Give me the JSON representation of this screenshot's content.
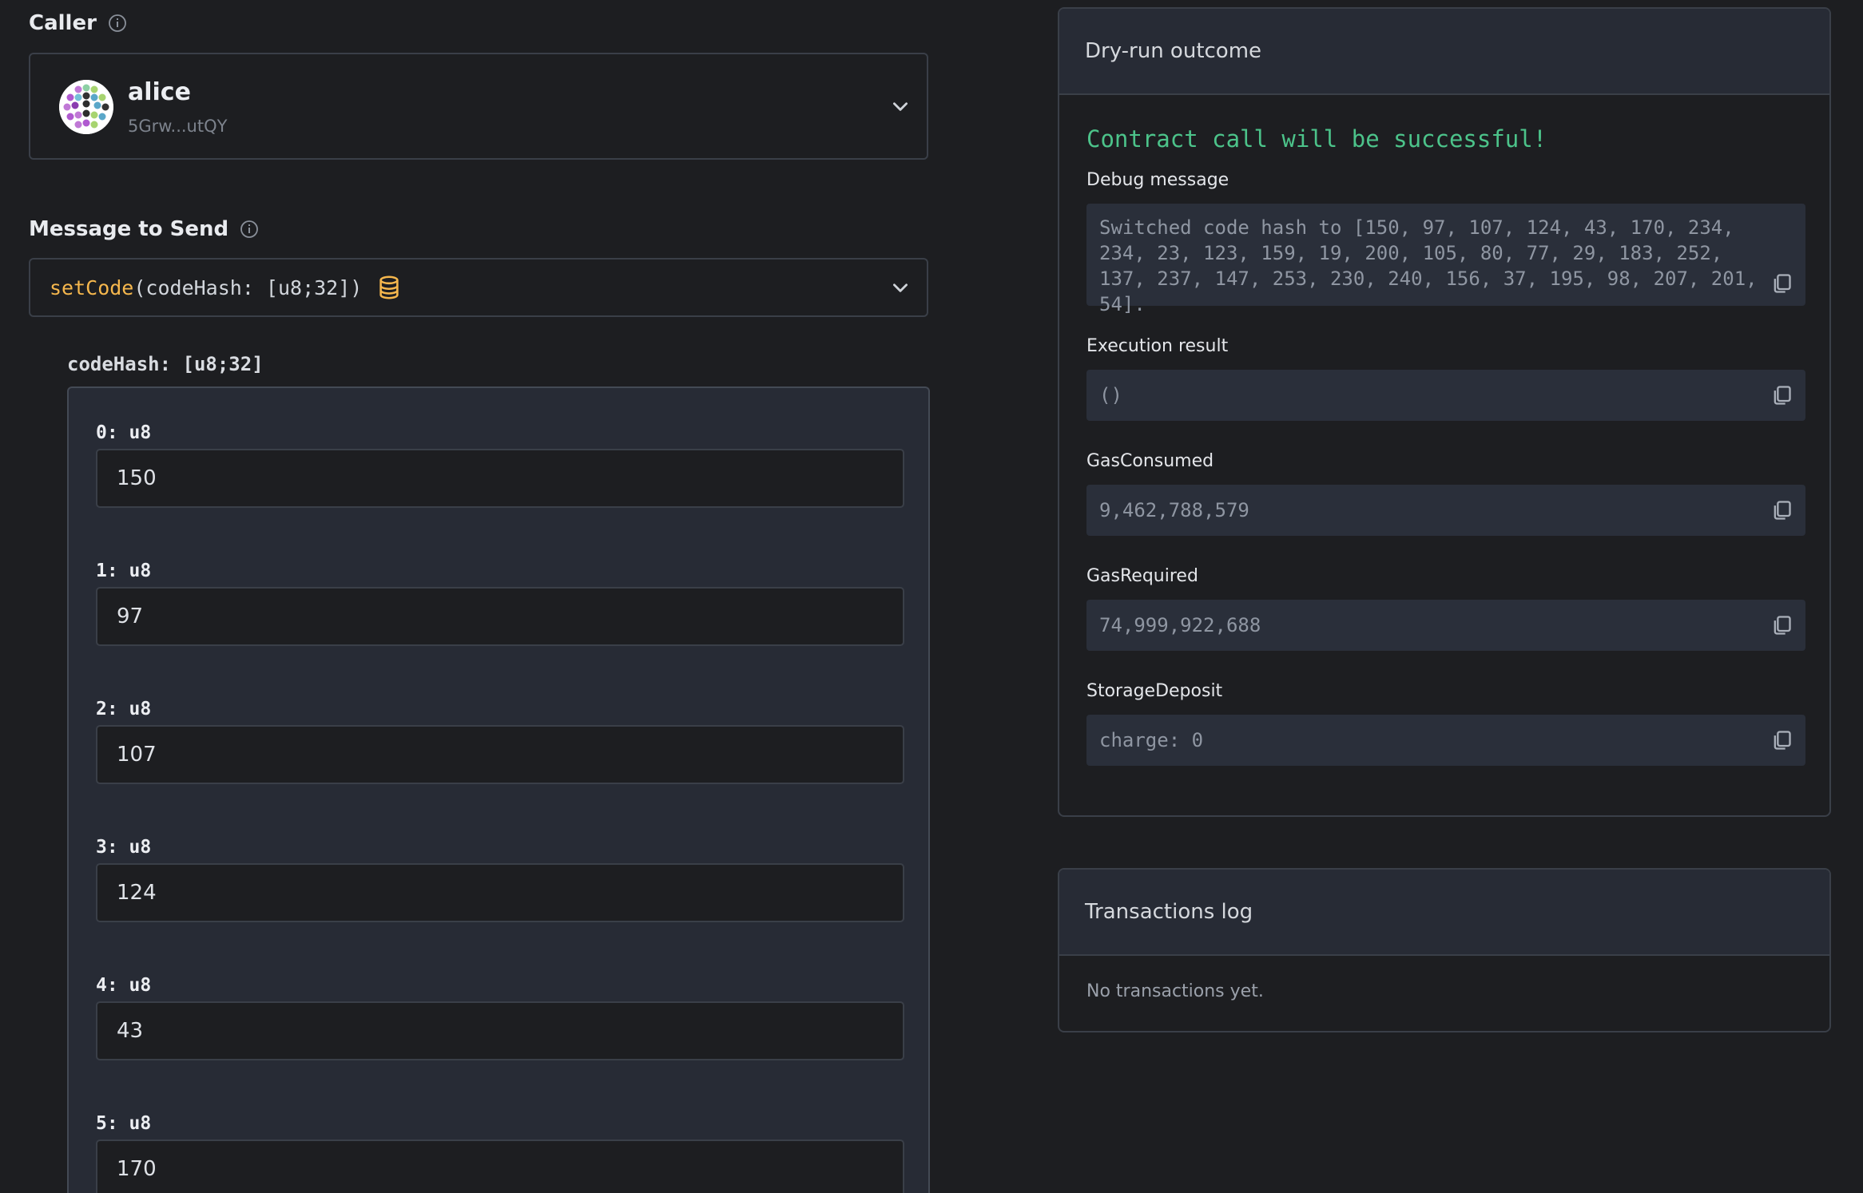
{
  "caller": {
    "label": "Caller",
    "account_name": "alice",
    "account_address": "5Grw...utQY"
  },
  "message": {
    "label": "Message to Send",
    "function_name": "setCode",
    "function_args": "(codeHash: [u8;32])"
  },
  "parameter": {
    "label": "codeHash: [u8;32]",
    "fields": [
      {
        "label": "0: u8",
        "value": "150"
      },
      {
        "label": "1: u8",
        "value": "97"
      },
      {
        "label": "2: u8",
        "value": "107"
      },
      {
        "label": "3: u8",
        "value": "124"
      },
      {
        "label": "4: u8",
        "value": "43"
      },
      {
        "label": "5: u8",
        "value": "170"
      }
    ]
  },
  "dry_run": {
    "title": "Dry-run outcome",
    "status": "Contract call will be successful!",
    "debug_label": "Debug message",
    "debug_value": "Switched code hash to [150, 97, 107, 124, 43, 170, 234, 234, 23, 123, 159, 19, 200, 105, 80, 77, 29, 183, 252, 137, 237, 147, 253, 230, 240, 156, 37, 195, 98, 207, 201, 54].",
    "execution_label": "Execution result",
    "execution_value": "()",
    "gas_consumed_label": "GasConsumed",
    "gas_consumed_value": "9,462,788,579",
    "gas_required_label": "GasRequired",
    "gas_required_value": "74,999,922,688",
    "storage_label": "StorageDeposit",
    "storage_value": "charge: 0"
  },
  "tx_log": {
    "title": "Transactions log",
    "empty_text": "No transactions yet."
  },
  "colors": {
    "background": "#1d1e21",
    "panel": "#272b35",
    "success": "#4cc38a",
    "function_accent": "#f5b74d"
  },
  "icons": [
    "info-icon",
    "chevron-down-icon",
    "database-icon",
    "copy-icon",
    "identicon-avatar"
  ]
}
